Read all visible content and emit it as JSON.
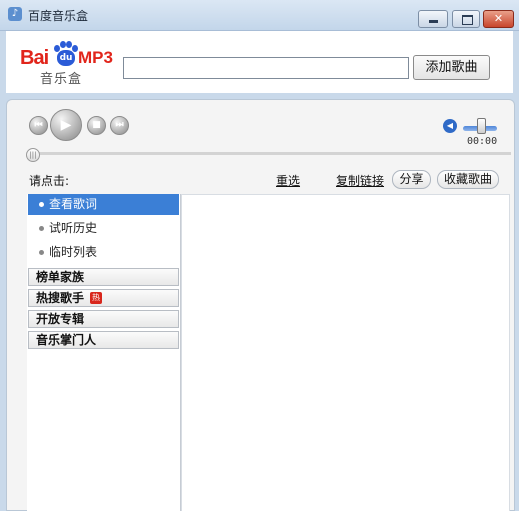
{
  "window": {
    "title": "百度音乐盒",
    "min_glyph": "",
    "max_glyph": "",
    "close_glyph": "✕",
    "app_icon_glyph": "♪"
  },
  "header": {
    "logo_bai": "Bai",
    "logo_du": "du",
    "logo_mp3": "MP3",
    "logo_subtitle": "音乐盒",
    "search_value": "",
    "add_button_label": "添加歌曲"
  },
  "player": {
    "prev_glyph": "⏮",
    "play_glyph": "▶",
    "stop_glyph": "■",
    "next_glyph": "⏭",
    "volume_glyph": "◀",
    "time": "00:00",
    "volume_level": 0.6,
    "progress": 0
  },
  "toolbar": {
    "prompt": "请点击:",
    "reselect": "重选",
    "copy_link": "复制链接",
    "share": "分享",
    "favorite": "收藏歌曲"
  },
  "sidebar": {
    "items": [
      {
        "label": "查看歌词",
        "active": true
      },
      {
        "label": "试听历史",
        "active": false
      },
      {
        "label": "临时列表",
        "active": false
      }
    ],
    "groups": [
      {
        "label": "榜单家族"
      },
      {
        "label": "热搜歌手",
        "badge": "热"
      },
      {
        "label": "开放专辑"
      },
      {
        "label": "音乐掌门人"
      }
    ]
  },
  "colors": {
    "accent": "#3b7fd6",
    "brand_red": "#e1251b",
    "brand_blue": "#2b5bd7",
    "hot_badge": "#d8261c"
  }
}
